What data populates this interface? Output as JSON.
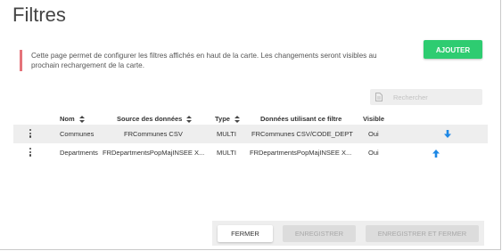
{
  "page": {
    "title": "Filtres",
    "info": "Cette page permet de configurer les filtres affichés en haut de la carte. Les changements seront visibles au prochain rechargement de la carte."
  },
  "toolbar": {
    "add_label": "AJOUTER",
    "add_color": "#2ecc71",
    "search_placeholder": "Rechercher"
  },
  "table": {
    "columns": [
      "Nom",
      "Source des données",
      "Type",
      "Données utilisant ce filtre",
      "Visible"
    ],
    "rows": [
      {
        "name": "Communes",
        "source": "FRCommunes CSV",
        "type": "MULTI",
        "data": "FRCommunes CSV/CODE_DEPT",
        "visible": "Oui",
        "move_icon": "arrow-down-icon"
      },
      {
        "name": "Departments",
        "source": "FRDepartmentsPopMajINSEE X...",
        "type": "MULTI",
        "data": "FRDepartmentsPopMajINSEE X...",
        "visible": "Oui",
        "move_icon": "arrow-up-icon"
      }
    ]
  },
  "footer": {
    "close_label": "FERMER",
    "save_label": "ENREGISTRER",
    "save_close_label": "ENREGISTRER ET FERMER"
  },
  "colors": {
    "accent_blue": "#1e88e5",
    "warning_bar": "#e5737a"
  }
}
